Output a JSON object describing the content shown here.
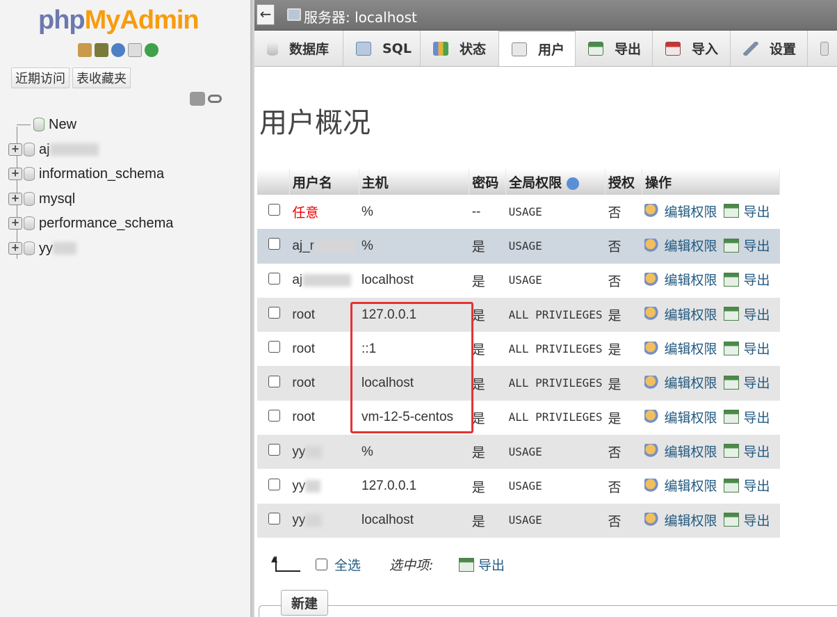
{
  "nav": {
    "logo_php": "php",
    "logo_myadmin": "MyAdmin",
    "tab_recent": "近期访问",
    "tab_favorites": "表收藏夹",
    "tree": [
      {
        "label": "New"
      },
      {
        "label": "aj"
      },
      {
        "label": "information_schema"
      },
      {
        "label": "mysql"
      },
      {
        "label": "performance_schema"
      },
      {
        "label": "yy"
      }
    ]
  },
  "topbar": {
    "back": "←",
    "server_title": "服务器: localhost"
  },
  "tabs": [
    {
      "label": "数据库",
      "icon": "database-icon"
    },
    {
      "label": "SQL",
      "icon": "sql-icon"
    },
    {
      "label": "状态",
      "icon": "status-icon"
    },
    {
      "label": "用户",
      "icon": "users-icon",
      "active": true
    },
    {
      "label": "导出",
      "icon": "export-icon"
    },
    {
      "label": "导入",
      "icon": "import-icon"
    },
    {
      "label": "设置",
      "icon": "settings-icon"
    }
  ],
  "main": {
    "title": "用户概况",
    "headers": {
      "user": "用户名",
      "host": "主机",
      "password": "密码",
      "global": "全局权限",
      "grant": "授权",
      "action": "操作"
    },
    "rows": [
      {
        "user": "任意",
        "host": "%",
        "password": "--",
        "priv": "USAGE",
        "grant": "否"
      },
      {
        "user": "aj_r",
        "host": "%",
        "password": "是",
        "priv": "USAGE",
        "grant": "否"
      },
      {
        "user": "aj",
        "host": "localhost",
        "password": "是",
        "priv": "USAGE",
        "grant": "否"
      },
      {
        "user": "root",
        "host": "127.0.0.1",
        "password": "是",
        "priv": "ALL PRIVILEGES",
        "grant": "是"
      },
      {
        "user": "root",
        "host": "::1",
        "password": "是",
        "priv": "ALL PRIVILEGES",
        "grant": "是"
      },
      {
        "user": "root",
        "host": "localhost",
        "password": "是",
        "priv": "ALL PRIVILEGES",
        "grant": "是"
      },
      {
        "user": "root",
        "host": "vm-12-5-centos",
        "password": "是",
        "priv": "ALL PRIVILEGES",
        "grant": "是"
      },
      {
        "user": "yy",
        "host": "%",
        "password": "是",
        "priv": "USAGE",
        "grant": "否"
      },
      {
        "user": "yy",
        "host": "127.0.0.1",
        "password": "是",
        "priv": "USAGE",
        "grant": "否"
      },
      {
        "user": "yy",
        "host": "localhost",
        "password": "是",
        "priv": "USAGE",
        "grant": "否"
      }
    ],
    "edit_label": "编辑权限",
    "export_label": "导出",
    "select_all": "全选",
    "with_selected": "选中项:",
    "footer_export": "导出",
    "new_legend": "新建"
  }
}
